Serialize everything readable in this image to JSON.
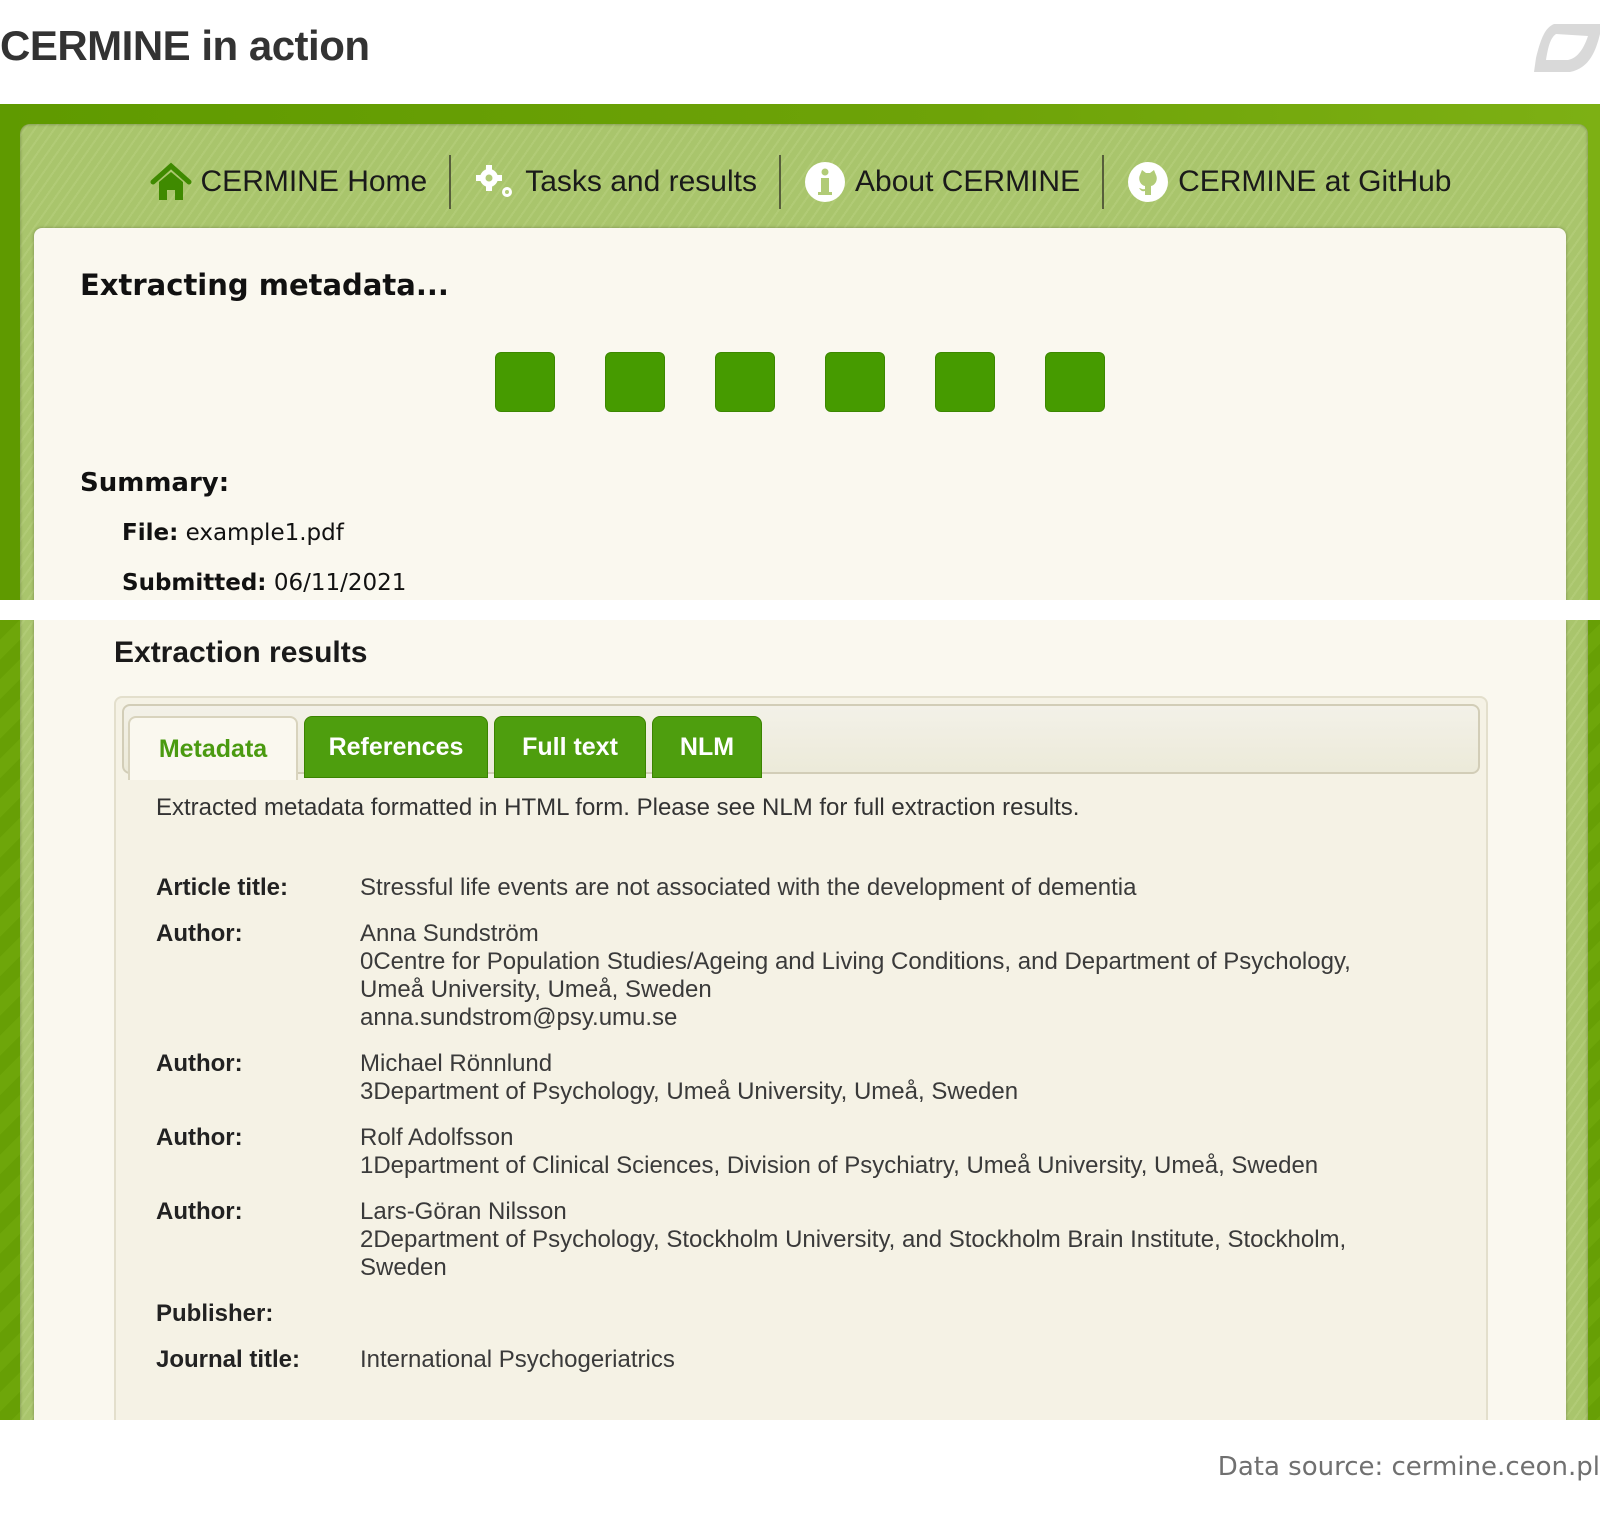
{
  "header": {
    "title": "CERMINE in action"
  },
  "nav": {
    "items": [
      {
        "label": "CERMINE Home",
        "icon": "home-icon"
      },
      {
        "label": "Tasks and results",
        "icon": "gears-icon"
      },
      {
        "label": "About CERMINE",
        "icon": "info-icon"
      },
      {
        "label": "CERMINE at GitHub",
        "icon": "github-icon"
      }
    ]
  },
  "extraction": {
    "heading": "Extracting metadata...",
    "progress_blocks": 6,
    "summary_heading": "Summary:",
    "file_label": "File:",
    "file_value": "example1.pdf",
    "submitted_label": "Submitted:",
    "submitted_value": "06/11/2021"
  },
  "results": {
    "heading": "Extraction results",
    "tabs": [
      {
        "label": "Metadata",
        "active": true
      },
      {
        "label": "References",
        "active": false
      },
      {
        "label": "Full text",
        "active": false
      },
      {
        "label": "NLM",
        "active": false
      }
    ],
    "description": "Extracted metadata formatted in HTML form. Please see NLM for full extraction results.",
    "metadata": [
      {
        "label": "Article title:",
        "lines": [
          "Stressful life events are not associated with the development of dementia"
        ]
      },
      {
        "label": "Author:",
        "lines": [
          "Anna Sundström",
          "0Centre for Population Studies/Ageing and Living Conditions, and Department of Psychology,",
          "Umeå University, Umeå, Sweden",
          "anna.sundstrom@psy.umu.se"
        ]
      },
      {
        "label": "Author:",
        "lines": [
          "Michael Rönnlund",
          "3Department of Psychology, Umeå University, Umeå, Sweden"
        ]
      },
      {
        "label": "Author:",
        "lines": [
          "Rolf Adolfsson",
          "1Department of Clinical Sciences, Division of Psychiatry, Umeå University, Umeå, Sweden"
        ]
      },
      {
        "label": "Author:",
        "lines": [
          "Lars-Göran Nilsson",
          "2Department of Psychology, Stockholm University, and Stockholm Brain Institute, Stockholm,",
          "Sweden"
        ]
      },
      {
        "label": "Publisher:",
        "lines": [
          ""
        ]
      },
      {
        "label": "Journal title:",
        "lines": [
          "International Psychogeriatrics"
        ]
      }
    ]
  },
  "footer": {
    "source": "Data source: cermine.ceon.pl"
  },
  "colors": {
    "brand_green": "#469b00",
    "tab_green": "#4e9e0e",
    "nav_bg": "#b1cb76",
    "card_bg": "#faf8ef"
  }
}
